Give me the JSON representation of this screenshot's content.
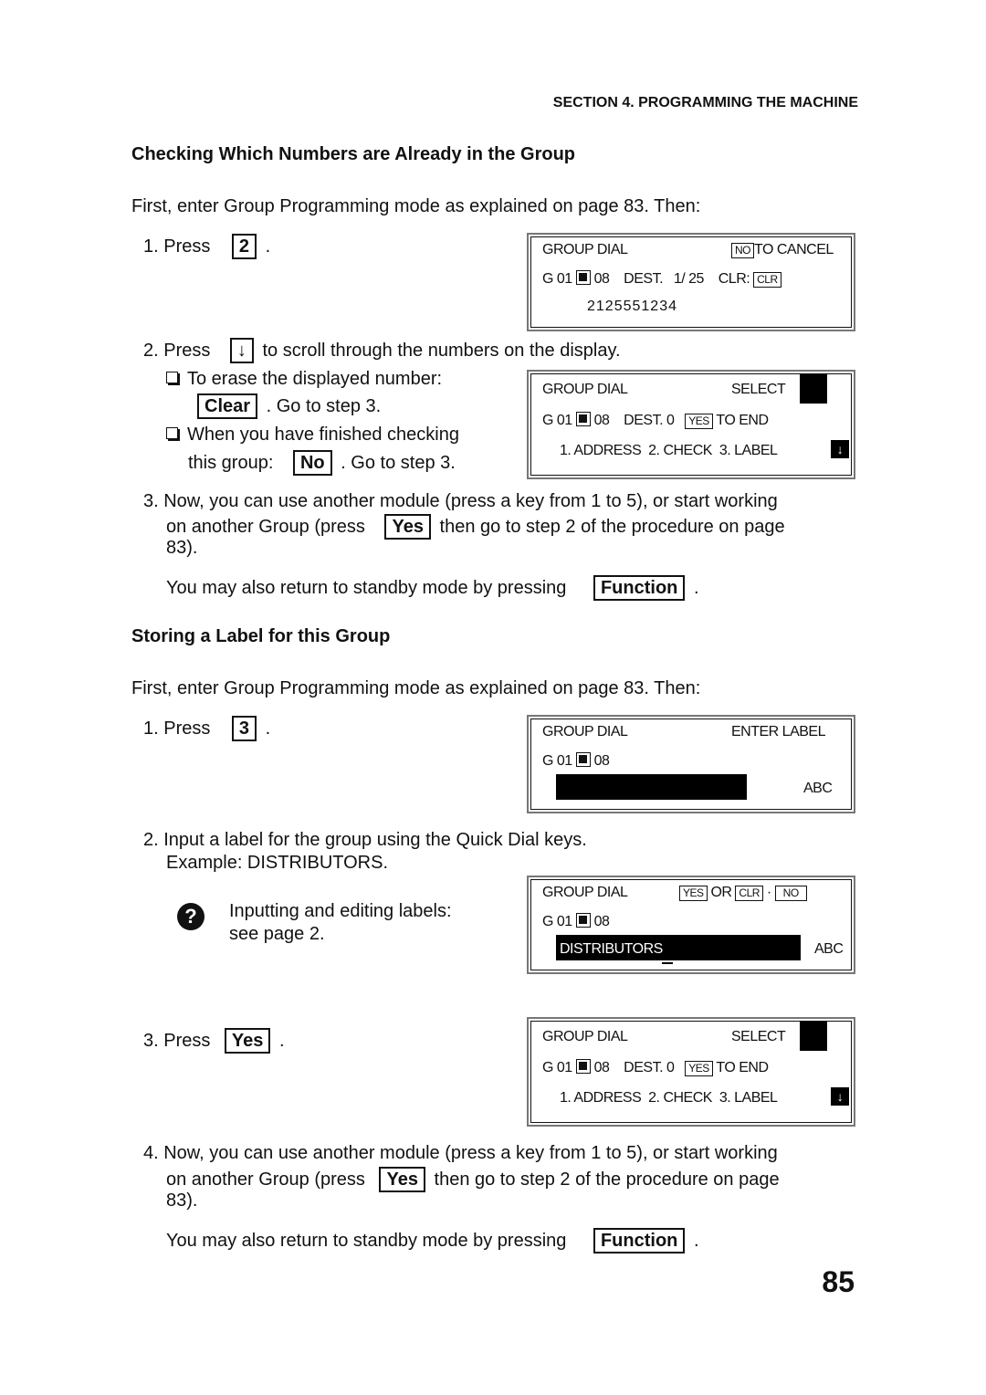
{
  "header": {
    "section": "SECTION 4. PROGRAMMING THE MACHINE"
  },
  "page_number": "85",
  "sec1": {
    "title": "Checking Which Numbers are Already in the Group",
    "intro": "First, enter Group Programming mode as explained on page   83. Then:",
    "step1": {
      "pre": "1. Press",
      "key": "2",
      "post": "."
    },
    "step2": {
      "pre": "2. Press",
      "key": "↓",
      "post": "to scroll through the numbers on the display."
    },
    "bullet1": {
      "line1": "To erase the displayed number:",
      "key": "Clear",
      "post": ". Go to step 3."
    },
    "bullet2": {
      "line1": "When you have finished checking",
      "pre": "this group:",
      "key": "No",
      "post": ". Go to step 3."
    },
    "step3": {
      "line1": "3. Now, you can use another module (press a key from 1 to 5), or start working",
      "pre": "on another Group (press",
      "key": "Yes",
      "post": "then go to step 2 of the procedure on page",
      "line3": "83)."
    },
    "standby": {
      "pre": "You may also return to standby mode by pressing",
      "key": "Function",
      "post": "."
    }
  },
  "sec2": {
    "title": "Storing a Label for this Group",
    "intro": "First, enter Group Programming mode as explained on page   83. Then:",
    "step1": {
      "pre": "1. Press",
      "key": "3",
      "post": "."
    },
    "step2": {
      "line1": "2. Input a label for the group using the Quick Dial keys.",
      "line2": "Example: DISTRIBUTORS."
    },
    "tip": {
      "icon": "question-icon",
      "line1": "Inputting and editing labels:",
      "line2": "see page 2."
    },
    "step3": {
      "pre": "3. Press",
      "key": "Yes",
      "post": "."
    },
    "step4": {
      "line1": "4. Now, you can use another module (press a key from 1 to 5), or start working",
      "pre": "on another Group (press",
      "key": "Yes",
      "post": "then go to step 2 of the procedure on page",
      "line3": "83)."
    },
    "standby": {
      "pre": "You may also return to standby mode by pressing",
      "key": "Function",
      "post": "."
    }
  },
  "lcd1": {
    "title": "GROUP DIAL",
    "key1": "NO",
    "right1": "TO CANCEL",
    "group": "G 01",
    "num": "08",
    "dest": "DEST.",
    "count": "1/ 25",
    "clr": "CLR:",
    "clrkey": "CLR",
    "line3": "2125551234"
  },
  "lcd2": {
    "title": "GROUP DIAL",
    "right1": "SELECT",
    "group": "G 01",
    "num": "08",
    "dest": "DEST. 0",
    "key": "YES",
    "toend": "TO END",
    "menu": "1. ADDRESS  2. CHECK  3. LABEL",
    "arrow": "↓"
  },
  "lcd3": {
    "title": "GROUP DIAL",
    "right1": "ENTER LABEL",
    "group": "G 01",
    "num": "08",
    "mode": "ABC"
  },
  "lcd4": {
    "title": "GROUP DIAL",
    "k1": "YES",
    "or": "OR",
    "k2": "CLR",
    "dot": "·",
    "k3": "NO",
    "group": "G 01",
    "num": "08",
    "label": "DISTRIBUTORS",
    "mode": "ABC"
  },
  "lcd5": {
    "title": "GROUP DIAL",
    "right1": "SELECT",
    "group": "G 01",
    "num": "08",
    "dest": "DEST. 0",
    "key": "YES",
    "toend": "TO END",
    "menu": "1. ADDRESS  2. CHECK  3. LABEL",
    "arrow": "↓"
  }
}
